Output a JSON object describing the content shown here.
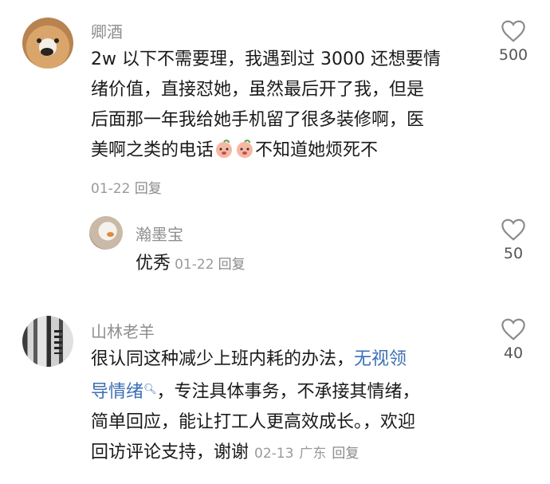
{
  "comments": [
    {
      "author": "卿酒",
      "text_line1": "2w 以下不需要理，我遇到过 3000 还想要情",
      "text_line2": "绪价值，直接怼她，虽然最后开了我，但是",
      "text_line3": "后面那一年我给她手机留了很多装修啊，医",
      "text_line4a": "美啊之类的电话",
      "text_line4b": "不知道她烦死不",
      "emoji": "peach-face-emoji",
      "date": "01-22",
      "reply_label": "回复",
      "likes": "500"
    },
    {
      "author": "瀚墨宝",
      "text": "优秀",
      "date": "01-22",
      "reply_label": "回复",
      "likes": "50"
    },
    {
      "author": "山林老羊",
      "text_line1a": "很认同这种减少上班内耗的办法，",
      "link_line1": "无视领",
      "link_line2": "导情绪",
      "text_line2b": "，专注具体事务，不承接其情绪，",
      "text_line3": "简单回应，能让打工人更高效成长。，欢迎",
      "text_line4": "回访评论支持，谢谢",
      "date": "02-13",
      "location": "广东",
      "reply_label": "回复",
      "likes": "40"
    }
  ],
  "colors": {
    "link": "#3c6fb4",
    "meta": "#9a9a9a",
    "name": "#8e8e8e"
  }
}
